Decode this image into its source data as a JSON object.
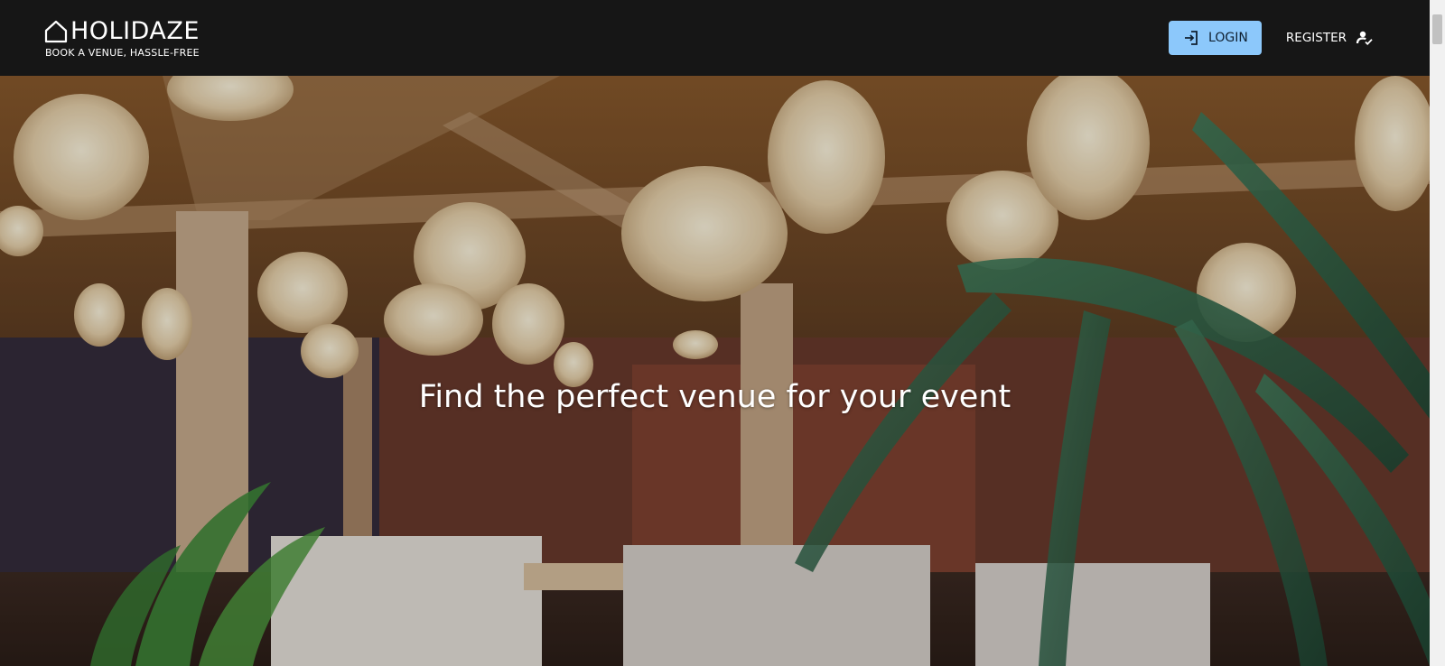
{
  "brand": {
    "name": "HOLIDAZE",
    "tagline": "BOOK A VENUE, HASSLE-FREE"
  },
  "nav": {
    "login_label": "LOGIN",
    "register_label": "REGISTER"
  },
  "hero": {
    "title": "Find the perfect venue for your event"
  },
  "icons": {
    "brand": "house-icon",
    "login": "login-icon",
    "register": "person-check-icon"
  },
  "colors": {
    "header_bg": "#161616",
    "login_button": "#8cc8fb",
    "text_light": "#ffffff"
  }
}
